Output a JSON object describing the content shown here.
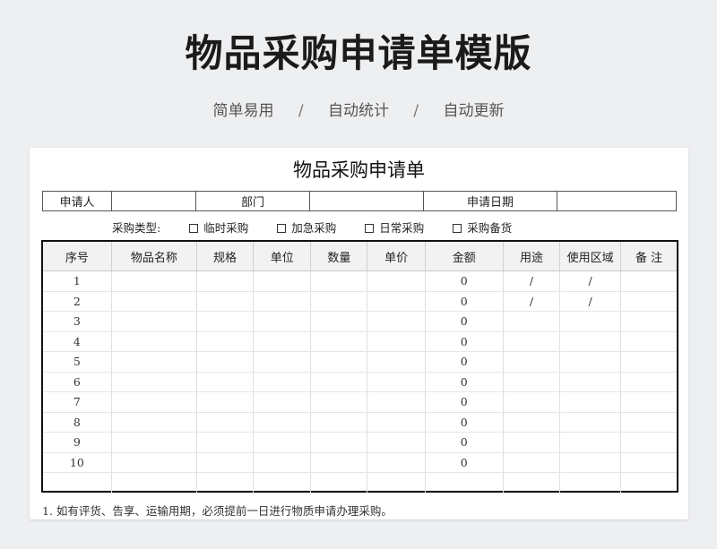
{
  "hero": {
    "title": "物品采购申请单模版",
    "tags": [
      "简单易用",
      "自动统计",
      "自动更新"
    ],
    "separator": "/"
  },
  "form": {
    "title": "物品采购申请单",
    "info": {
      "applicant_label": "申请人",
      "applicant_value": "",
      "dept_label": "部门",
      "dept_value": "",
      "date_label": "申请日期",
      "date_value": ""
    },
    "purchase_type": {
      "label": "采购类型:",
      "options": [
        {
          "label": "临时采购",
          "checked": false
        },
        {
          "label": "加急采购",
          "checked": false
        },
        {
          "label": "日常采购",
          "checked": false
        },
        {
          "label": "采购备货",
          "checked": false
        }
      ]
    },
    "table": {
      "headers": [
        "序号",
        "物品名称",
        "规格",
        "单位",
        "数量",
        "单价",
        "金额",
        "用途",
        "使用区域",
        "备 注"
      ],
      "rows": [
        [
          "1",
          "",
          "",
          "",
          "",
          "",
          "0",
          "/",
          "/",
          ""
        ],
        [
          "2",
          "",
          "",
          "",
          "",
          "",
          "0",
          "/",
          "/",
          ""
        ],
        [
          "3",
          "",
          "",
          "",
          "",
          "",
          "0",
          "",
          "",
          ""
        ],
        [
          "4",
          "",
          "",
          "",
          "",
          "",
          "0",
          "",
          "",
          ""
        ],
        [
          "5",
          "",
          "",
          "",
          "",
          "",
          "0",
          "",
          "",
          ""
        ],
        [
          "6",
          "",
          "",
          "",
          "",
          "",
          "0",
          "",
          "",
          ""
        ],
        [
          "7",
          "",
          "",
          "",
          "",
          "",
          "0",
          "",
          "",
          ""
        ],
        [
          "8",
          "",
          "",
          "",
          "",
          "",
          "0",
          "",
          "",
          ""
        ],
        [
          "9",
          "",
          "",
          "",
          "",
          "",
          "0",
          "",
          "",
          ""
        ],
        [
          "10",
          "",
          "",
          "",
          "",
          "",
          "0",
          "",
          "",
          ""
        ],
        [
          "",
          "",
          "",
          "",
          "",
          "",
          "",
          "",
          "",
          ""
        ]
      ]
    },
    "note": "1. 如有评货、告享、运输用期，必须提前一日进行物质申请办理采购。"
  }
}
